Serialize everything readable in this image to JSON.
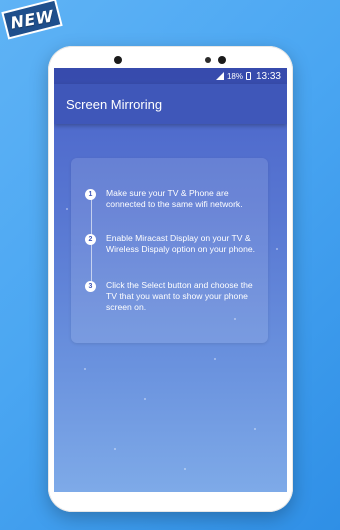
{
  "badge": {
    "label": "NEW",
    "color": "#1f4f8c"
  },
  "status_bar": {
    "battery": "18%",
    "time": "13:33",
    "icons": [
      "signal-icon",
      "battery-icon"
    ]
  },
  "app_bar": {
    "title": "Screen Mirroring",
    "color": "#3f57b9"
  },
  "steps": [
    {
      "number": "1",
      "text": "Make sure your TV & Phone are connected to the same wifi network."
    },
    {
      "number": "2",
      "text": "Enable Miracast Display on your TV & Wireless Dispaly option on your phone."
    },
    {
      "number": "3",
      "text": "Click the Select button and choose the TV that you want to show your phone screen on."
    }
  ]
}
